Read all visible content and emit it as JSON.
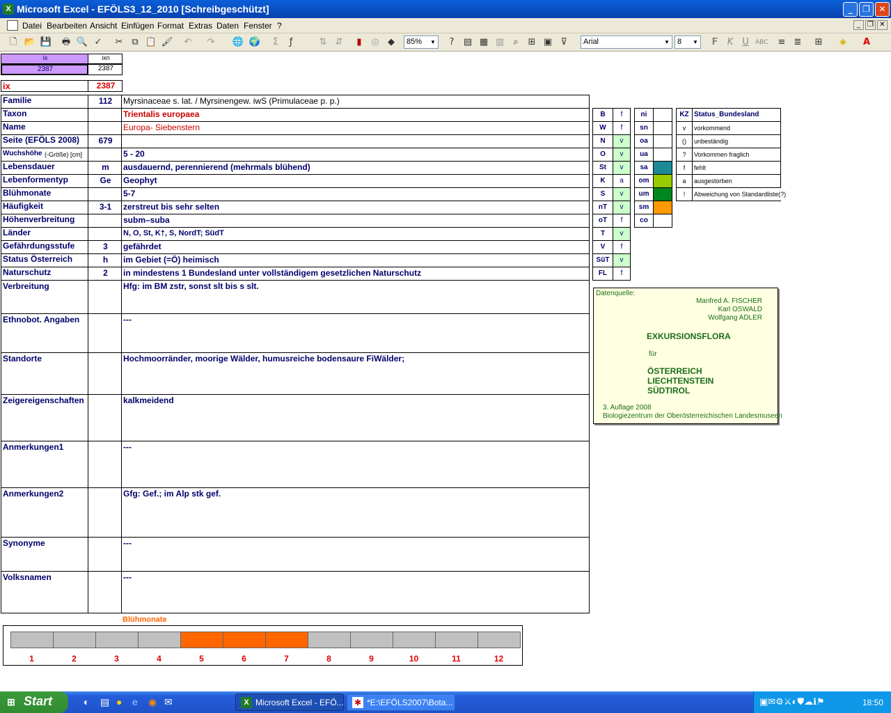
{
  "window": {
    "title": "Microsoft Excel - EFÖLS3_12_2010  [Schreibgeschützt]",
    "logo": "X"
  },
  "menu": [
    "Datei",
    "Bearbeiten",
    "Ansicht",
    "Einfügen",
    "Format",
    "Extras",
    "Daten",
    "Fenster",
    "?"
  ],
  "toolbar": {
    "zoom": "85%",
    "font": "Arial",
    "size": "8"
  },
  "index": {
    "ix_label": "ix",
    "ixn_label": "ixn",
    "ix_value": "2387",
    "ixn_value": "2387",
    "ix_red_label": "ix",
    "ix_red_value": "2387"
  },
  "rows": [
    {
      "label": "Familie",
      "code": "112",
      "value": "Myrsinaceae s. lat.  /  Myrsinengew. iwS (Primulaceae p. p.)"
    },
    {
      "label": "Taxon",
      "code": "",
      "value": "Trientalis europaea"
    },
    {
      "label": "Name",
      "code": "",
      "value": "Europa- Siebenstern"
    },
    {
      "label": "Seite (EFÖLS 2008)",
      "code": "679",
      "value": ""
    },
    {
      "label": "Wuchshöhe",
      "label_small": "(-Größe) [cm]",
      "code": "",
      "value": " 5 - 20"
    },
    {
      "label": "Lebensdauer",
      "code": "m",
      "value": "ausdauernd, perennierend (mehrmals blühend)"
    },
    {
      "label": "Lebenformentyp",
      "code": "Ge",
      "value": "Geophyt"
    },
    {
      "label": "Blühmonate",
      "code": "",
      "value": " 5-7"
    },
    {
      "label": "Häufigkeit",
      "code": "3-1",
      "value": "zerstreut bis sehr selten"
    },
    {
      "label": "Höhenverbreitung",
      "code": "",
      "value": "subm–suba"
    },
    {
      "label": "Länder",
      "code": "",
      "value": "N, O, St, K†, S, NordT; SüdT"
    },
    {
      "label": "Gefährdungsstufe",
      "code": "3",
      "value": "gefährdet"
    },
    {
      "label": "Status Österreich",
      "code": "h",
      "value": "im Gebiet (=Ö) heimisch"
    },
    {
      "label": "Naturschutz",
      "code": "2",
      "value": "in mindestens 1 Bundesland unter vollständigem gesetzlichen Naturschutz"
    }
  ],
  "big_rows": [
    {
      "label": "Verbreitung",
      "value": "Hfg:  im BM zstr, sonst slt bis s slt."
    },
    {
      "label": "Ethnobot. Angaben",
      "value": "---"
    },
    {
      "label": "Standorte",
      "value": "Hochmoorränder, moorige Wälder, humusreiche bodensaure FiWälder;"
    },
    {
      "label": "Zeigereigenschaften",
      "value": "kalkmeidend"
    },
    {
      "label": "Anmerkungen1",
      "value": "---"
    },
    {
      "label": "Anmerkungen2",
      "value": "Gfg: Gef.; im Alp stk gef."
    },
    {
      "label": "Synonyme",
      "value": "---"
    },
    {
      "label": "Volksnamen",
      "value": "---"
    }
  ],
  "states": [
    {
      "code": "B",
      "status": "f"
    },
    {
      "code": "W",
      "status": "f"
    },
    {
      "code": "N",
      "status": "v"
    },
    {
      "code": "O",
      "status": "v"
    },
    {
      "code": "St",
      "status": "v"
    },
    {
      "code": "K",
      "status": "a"
    },
    {
      "code": "S",
      "status": "v"
    },
    {
      "code": "nT",
      "status": "v"
    },
    {
      "code": "oT",
      "status": "f"
    },
    {
      "code": "T",
      "status": "v"
    },
    {
      "code": "V",
      "status": "f"
    },
    {
      "code": "SüT",
      "status": "v"
    },
    {
      "code": "FL",
      "status": "f"
    }
  ],
  "zones": [
    {
      "code": "ni",
      "color": "#ffffff"
    },
    {
      "code": "sn",
      "color": "#ffffff"
    },
    {
      "code": "oa",
      "color": "#ffffff"
    },
    {
      "code": "ua",
      "color": "#ffffff"
    },
    {
      "code": "sa",
      "color": "#1b8a96"
    },
    {
      "code": "om",
      "color": "#99cc00"
    },
    {
      "code": "um",
      "color": "#00861e"
    },
    {
      "code": "sm",
      "color": "#ff9900"
    },
    {
      "code": "co",
      "color": "#ffffff"
    }
  ],
  "legend": {
    "header_kz": "KZ",
    "header_title": "Status_Bundesland",
    "items": [
      {
        "kz": "v",
        "text": "vorkommend"
      },
      {
        "kz": "()",
        "text": "unbeständig"
      },
      {
        "kz": "?",
        "text": "Vorkommen fraglich"
      },
      {
        "kz": "f",
        "text": "fehlt"
      },
      {
        "kz": "a",
        "text": "ausgestorben"
      },
      {
        "kz": "!",
        "text": "Abweichung von Standardliste(?)"
      }
    ]
  },
  "source": {
    "label": "Datenquelle:",
    "author1": "Manfred A. FISCHER",
    "author2": "Karl OSWALD",
    "author3": "Wolfgang ADLER",
    "title": "EXKURSIONSFLORA",
    "fuer": "für",
    "country1": "ÖSTERREICH",
    "country2": "LIECHTENSTEIN",
    "country3": "SÜDTIROL",
    "edition": "3. Auflage 2008",
    "publisher": "Biologiezentrum der Oberösterreichischen Landesmuseen"
  },
  "chart_data": {
    "type": "bar",
    "title": "Blühmonate",
    "categories": [
      "1",
      "2",
      "3",
      "4",
      "5",
      "6",
      "7",
      "8",
      "9",
      "10",
      "11",
      "12"
    ],
    "values": [
      0,
      0,
      0,
      0,
      1,
      1,
      1,
      0,
      0,
      0,
      0,
      0
    ],
    "colors": {
      "flowering": "#ff6600",
      "not_flowering": "#c0c0c0"
    }
  },
  "taskbar": {
    "start": "Start",
    "items": [
      "Microsoft Excel - EFÖ...",
      "*E:\\EFÖLS2007\\Bota..."
    ],
    "clock": "18:50"
  }
}
